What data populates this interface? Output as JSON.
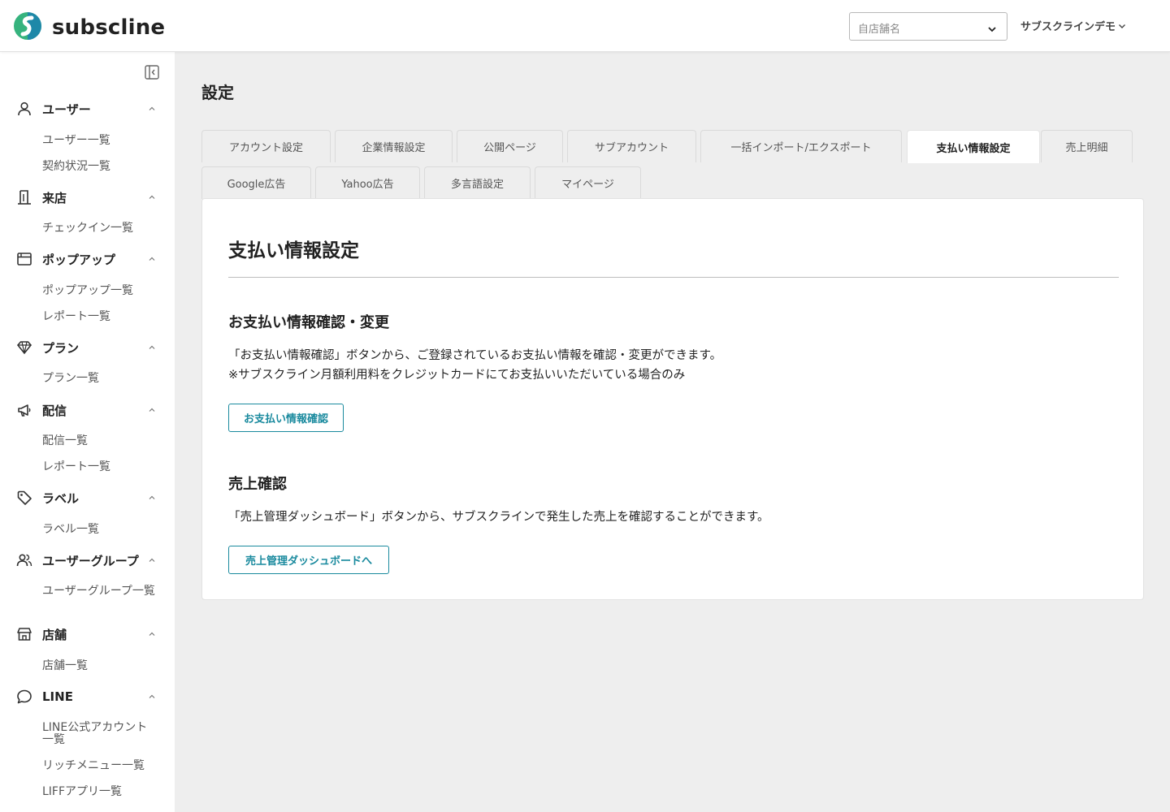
{
  "app": {
    "name": "subscline",
    "colors": {
      "accent": "#1a8a9e",
      "logo_green": "#36b37e",
      "logo_blue": "#1e88a8"
    }
  },
  "header": {
    "store_select": {
      "placeholder": "自店舗名",
      "icon": "chevron-down-icon"
    },
    "account_name": "サブスクラインデモ"
  },
  "sidebar": {
    "sections": [
      {
        "label": "ユーザー",
        "icon": "user-icon",
        "items": [
          "ユーザー一覧",
          "契約状況一覧"
        ]
      },
      {
        "label": "来店",
        "icon": "building-icon",
        "items": [
          "チェックイン一覧"
        ]
      },
      {
        "label": "ポップアップ",
        "icon": "browser-window-icon",
        "items": [
          "ポップアップ一覧",
          "レポート一覧"
        ]
      },
      {
        "label": "プラン",
        "icon": "diamond-icon",
        "items": [
          "プラン一覧"
        ]
      },
      {
        "label": "配信",
        "icon": "megaphone-icon",
        "items": [
          "配信一覧",
          "レポート一覧"
        ]
      },
      {
        "label": "ラベル",
        "icon": "tag-icon",
        "items": [
          "ラベル一覧"
        ]
      },
      {
        "label": "ユーザーグループ",
        "icon": "users-icon",
        "items": [
          "ユーザーグループ一覧"
        ]
      },
      {
        "label": "店舗",
        "icon": "store-icon",
        "items": [
          "店舗一覧"
        ]
      },
      {
        "label": "LINE",
        "icon": "chat-bubble-icon",
        "items": [
          "LINE公式アカウント一覧",
          "リッチメニュー一覧",
          "LIFFアプリ一覧"
        ]
      }
    ]
  },
  "main": {
    "page_title": "設定",
    "tabs_row1": [
      "アカウント設定",
      "企業情報設定",
      "公開ページ",
      "サブアカウント",
      "一括インポート/エクスポート",
      "支払い情報設定",
      "売上明細"
    ],
    "tabs_row2": [
      "Google広告",
      "Yahoo広告",
      "多言語設定",
      "マイページ"
    ],
    "active_tab": "支払い情報設定",
    "panel": {
      "title": "支払い情報設定",
      "payment": {
        "heading": "お支払い情報確認・変更",
        "line1": "「お支払い情報確認」ボタンから、ご登録されているお支払い情報を確認・変更ができます。",
        "line2": "※サブスクライン月額利用料をクレジットカードにてお支払いいただいている場合のみ",
        "button": "お支払い情報確認"
      },
      "sales": {
        "heading": "売上確認",
        "line1": "「売上管理ダッシュボード」ボタンから、サブスクラインで発生した売上を確認することができます。",
        "button": "売上管理ダッシュボードへ"
      }
    }
  }
}
